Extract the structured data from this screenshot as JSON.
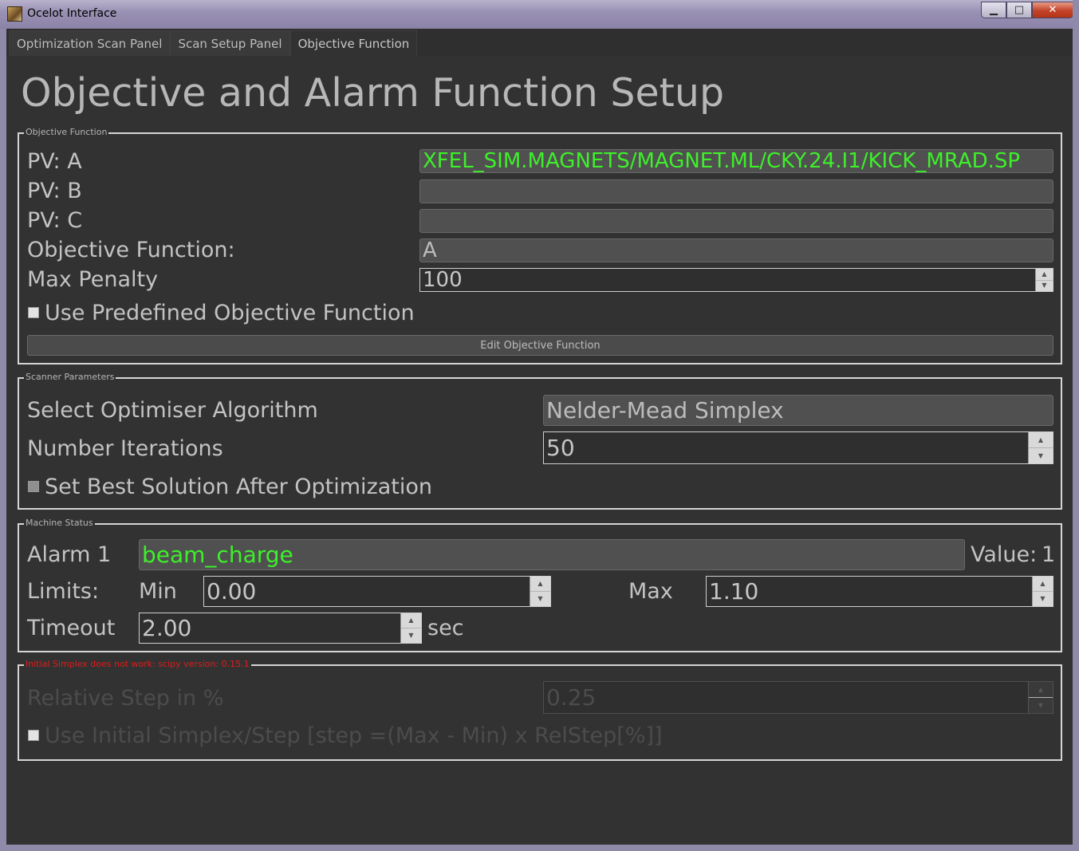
{
  "window": {
    "title": "Ocelot Interface",
    "minimize": "▁",
    "maximize": "□",
    "close": "✕"
  },
  "tabs": [
    {
      "label": "Optimization Scan Panel"
    },
    {
      "label": "Scan Setup Panel"
    },
    {
      "label": "Objective Function"
    }
  ],
  "page_title": "Objective and Alarm Function Setup",
  "objective": {
    "group_title": "Objective Function",
    "pv_a_label": "PV: A",
    "pv_a_value": "XFEL_SIM.MAGNETS/MAGNET.ML/CKY.24.I1/KICK_MRAD.SP",
    "pv_b_label": "PV: B",
    "pv_b_value": "",
    "pv_c_label": "PV: C",
    "pv_c_value": "",
    "function_label": "Objective Function:",
    "function_value": "A",
    "max_penalty_label": "Max Penalty",
    "max_penalty_value": "100",
    "use_predefined_label": "Use Predefined Objective Function",
    "edit_button": "Edit Objective Function"
  },
  "scanner": {
    "group_title": "Scanner Parameters",
    "algorithm_label": "Select Optimiser Algorithm",
    "algorithm_value": "Nelder-Mead Simplex",
    "iterations_label": "Number Iterations",
    "iterations_value": "50",
    "set_best_label": "Set Best Solution After Optimization"
  },
  "machine": {
    "group_title": "Machine Status",
    "alarm_label": "Alarm 1",
    "alarm_value": "beam_charge",
    "value_label": "Value:",
    "value_value": "1",
    "limits_label": "Limits:",
    "min_label": "Min",
    "min_value": "0.00",
    "max_label": "Max",
    "max_value": "1.10",
    "timeout_label": "Timeout",
    "timeout_value": "2.00",
    "timeout_unit": "sec"
  },
  "simplex": {
    "group_title": "Initial Simplex does not work: scipy version: 0.15.1",
    "rel_step_label": "Relative Step in %",
    "rel_step_value": "0.25",
    "use_initial_label": "Use Initial Simplex/Step [step =(Max - Min) x RelStep[%]]"
  },
  "colors": {
    "background": "#323232",
    "pv_text": "#3df02a",
    "warning": "#e21a1a"
  }
}
